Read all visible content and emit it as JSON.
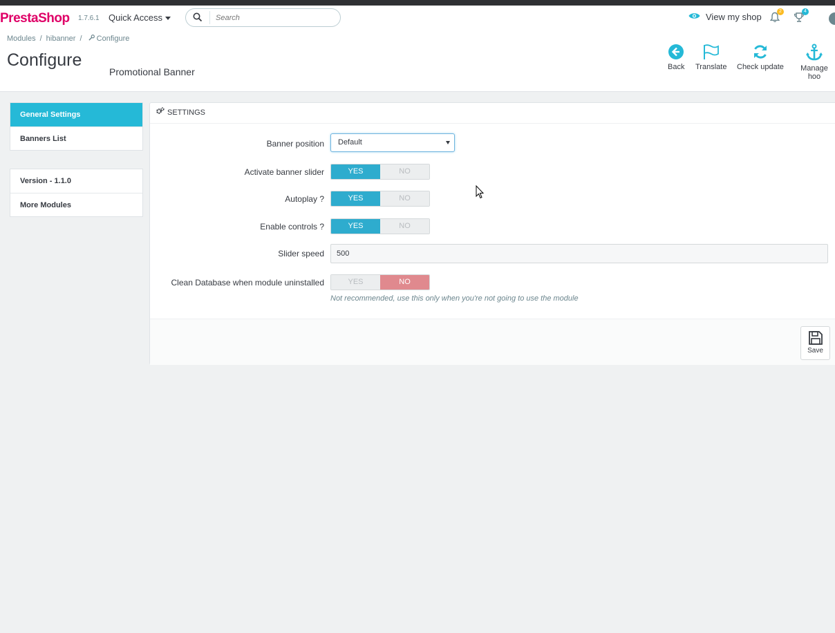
{
  "topbar": {
    "logo_presta": "Presta",
    "logo_shop": "Shop",
    "version": "1.7.6.1",
    "quick_access": "Quick Access",
    "search_placeholder": "Search",
    "view_my_shop": "View my shop",
    "notifications_count": "2",
    "trophy_count": "4"
  },
  "breadcrumb": [
    "Modules",
    "hibanner",
    "Configure"
  ],
  "page_title": "Configure",
  "subtitle": "Promotional Banner",
  "toolbar": {
    "back": "Back",
    "translate": "Translate",
    "check_update": "Check update",
    "manage_hooks": "Manage hoo"
  },
  "sidebar": {
    "group1": [
      "General Settings",
      "Banners List"
    ],
    "group2": [
      "Version - 1.1.0",
      "More Modules"
    ]
  },
  "panel": {
    "title": "SETTINGS",
    "banner_position_label": "Banner position",
    "banner_position_value": "Default",
    "activate_slider_label": "Activate banner slider",
    "autoplay_label": "Autoplay ?",
    "enable_controls_label": "Enable controls ?",
    "slider_speed_label": "Slider speed",
    "slider_speed_value": "500",
    "clean_db_label": "Clean Database when module uninstalled",
    "clean_db_help": "Not recommended, use this only when you're not going to use the module",
    "yes": "YES",
    "no": "NO",
    "save": "Save"
  },
  "colors": {
    "accent": "#25b9d7",
    "switch_on": "#2eacce",
    "switch_off": "#e0898e",
    "logo": "#df0067"
  }
}
